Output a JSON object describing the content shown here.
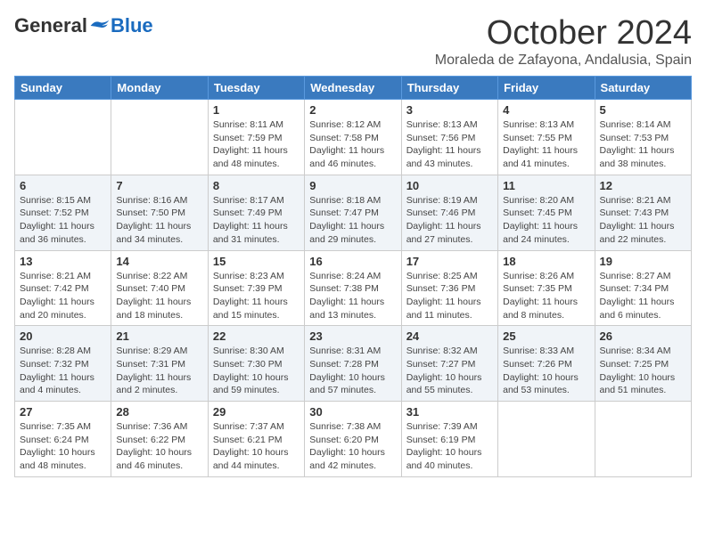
{
  "header": {
    "logo": {
      "general": "General",
      "blue": "Blue"
    },
    "title": "October 2024",
    "location": "Moraleda de Zafayona, Andalusia, Spain"
  },
  "calendar": {
    "days_of_week": [
      "Sunday",
      "Monday",
      "Tuesday",
      "Wednesday",
      "Thursday",
      "Friday",
      "Saturday"
    ],
    "weeks": [
      [
        {
          "day": "",
          "sunrise": "",
          "sunset": "",
          "daylight": ""
        },
        {
          "day": "",
          "sunrise": "",
          "sunset": "",
          "daylight": ""
        },
        {
          "day": "1",
          "sunrise": "Sunrise: 8:11 AM",
          "sunset": "Sunset: 7:59 PM",
          "daylight": "Daylight: 11 hours and 48 minutes."
        },
        {
          "day": "2",
          "sunrise": "Sunrise: 8:12 AM",
          "sunset": "Sunset: 7:58 PM",
          "daylight": "Daylight: 11 hours and 46 minutes."
        },
        {
          "day": "3",
          "sunrise": "Sunrise: 8:13 AM",
          "sunset": "Sunset: 7:56 PM",
          "daylight": "Daylight: 11 hours and 43 minutes."
        },
        {
          "day": "4",
          "sunrise": "Sunrise: 8:13 AM",
          "sunset": "Sunset: 7:55 PM",
          "daylight": "Daylight: 11 hours and 41 minutes."
        },
        {
          "day": "5",
          "sunrise": "Sunrise: 8:14 AM",
          "sunset": "Sunset: 7:53 PM",
          "daylight": "Daylight: 11 hours and 38 minutes."
        }
      ],
      [
        {
          "day": "6",
          "sunrise": "Sunrise: 8:15 AM",
          "sunset": "Sunset: 7:52 PM",
          "daylight": "Daylight: 11 hours and 36 minutes."
        },
        {
          "day": "7",
          "sunrise": "Sunrise: 8:16 AM",
          "sunset": "Sunset: 7:50 PM",
          "daylight": "Daylight: 11 hours and 34 minutes."
        },
        {
          "day": "8",
          "sunrise": "Sunrise: 8:17 AM",
          "sunset": "Sunset: 7:49 PM",
          "daylight": "Daylight: 11 hours and 31 minutes."
        },
        {
          "day": "9",
          "sunrise": "Sunrise: 8:18 AM",
          "sunset": "Sunset: 7:47 PM",
          "daylight": "Daylight: 11 hours and 29 minutes."
        },
        {
          "day": "10",
          "sunrise": "Sunrise: 8:19 AM",
          "sunset": "Sunset: 7:46 PM",
          "daylight": "Daylight: 11 hours and 27 minutes."
        },
        {
          "day": "11",
          "sunrise": "Sunrise: 8:20 AM",
          "sunset": "Sunset: 7:45 PM",
          "daylight": "Daylight: 11 hours and 24 minutes."
        },
        {
          "day": "12",
          "sunrise": "Sunrise: 8:21 AM",
          "sunset": "Sunset: 7:43 PM",
          "daylight": "Daylight: 11 hours and 22 minutes."
        }
      ],
      [
        {
          "day": "13",
          "sunrise": "Sunrise: 8:21 AM",
          "sunset": "Sunset: 7:42 PM",
          "daylight": "Daylight: 11 hours and 20 minutes."
        },
        {
          "day": "14",
          "sunrise": "Sunrise: 8:22 AM",
          "sunset": "Sunset: 7:40 PM",
          "daylight": "Daylight: 11 hours and 18 minutes."
        },
        {
          "day": "15",
          "sunrise": "Sunrise: 8:23 AM",
          "sunset": "Sunset: 7:39 PM",
          "daylight": "Daylight: 11 hours and 15 minutes."
        },
        {
          "day": "16",
          "sunrise": "Sunrise: 8:24 AM",
          "sunset": "Sunset: 7:38 PM",
          "daylight": "Daylight: 11 hours and 13 minutes."
        },
        {
          "day": "17",
          "sunrise": "Sunrise: 8:25 AM",
          "sunset": "Sunset: 7:36 PM",
          "daylight": "Daylight: 11 hours and 11 minutes."
        },
        {
          "day": "18",
          "sunrise": "Sunrise: 8:26 AM",
          "sunset": "Sunset: 7:35 PM",
          "daylight": "Daylight: 11 hours and 8 minutes."
        },
        {
          "day": "19",
          "sunrise": "Sunrise: 8:27 AM",
          "sunset": "Sunset: 7:34 PM",
          "daylight": "Daylight: 11 hours and 6 minutes."
        }
      ],
      [
        {
          "day": "20",
          "sunrise": "Sunrise: 8:28 AM",
          "sunset": "Sunset: 7:32 PM",
          "daylight": "Daylight: 11 hours and 4 minutes."
        },
        {
          "day": "21",
          "sunrise": "Sunrise: 8:29 AM",
          "sunset": "Sunset: 7:31 PM",
          "daylight": "Daylight: 11 hours and 2 minutes."
        },
        {
          "day": "22",
          "sunrise": "Sunrise: 8:30 AM",
          "sunset": "Sunset: 7:30 PM",
          "daylight": "Daylight: 10 hours and 59 minutes."
        },
        {
          "day": "23",
          "sunrise": "Sunrise: 8:31 AM",
          "sunset": "Sunset: 7:28 PM",
          "daylight": "Daylight: 10 hours and 57 minutes."
        },
        {
          "day": "24",
          "sunrise": "Sunrise: 8:32 AM",
          "sunset": "Sunset: 7:27 PM",
          "daylight": "Daylight: 10 hours and 55 minutes."
        },
        {
          "day": "25",
          "sunrise": "Sunrise: 8:33 AM",
          "sunset": "Sunset: 7:26 PM",
          "daylight": "Daylight: 10 hours and 53 minutes."
        },
        {
          "day": "26",
          "sunrise": "Sunrise: 8:34 AM",
          "sunset": "Sunset: 7:25 PM",
          "daylight": "Daylight: 10 hours and 51 minutes."
        }
      ],
      [
        {
          "day": "27",
          "sunrise": "Sunrise: 7:35 AM",
          "sunset": "Sunset: 6:24 PM",
          "daylight": "Daylight: 10 hours and 48 minutes."
        },
        {
          "day": "28",
          "sunrise": "Sunrise: 7:36 AM",
          "sunset": "Sunset: 6:22 PM",
          "daylight": "Daylight: 10 hours and 46 minutes."
        },
        {
          "day": "29",
          "sunrise": "Sunrise: 7:37 AM",
          "sunset": "Sunset: 6:21 PM",
          "daylight": "Daylight: 10 hours and 44 minutes."
        },
        {
          "day": "30",
          "sunrise": "Sunrise: 7:38 AM",
          "sunset": "Sunset: 6:20 PM",
          "daylight": "Daylight: 10 hours and 42 minutes."
        },
        {
          "day": "31",
          "sunrise": "Sunrise: 7:39 AM",
          "sunset": "Sunset: 6:19 PM",
          "daylight": "Daylight: 10 hours and 40 minutes."
        },
        {
          "day": "",
          "sunrise": "",
          "sunset": "",
          "daylight": ""
        },
        {
          "day": "",
          "sunrise": "",
          "sunset": "",
          "daylight": ""
        }
      ]
    ]
  }
}
